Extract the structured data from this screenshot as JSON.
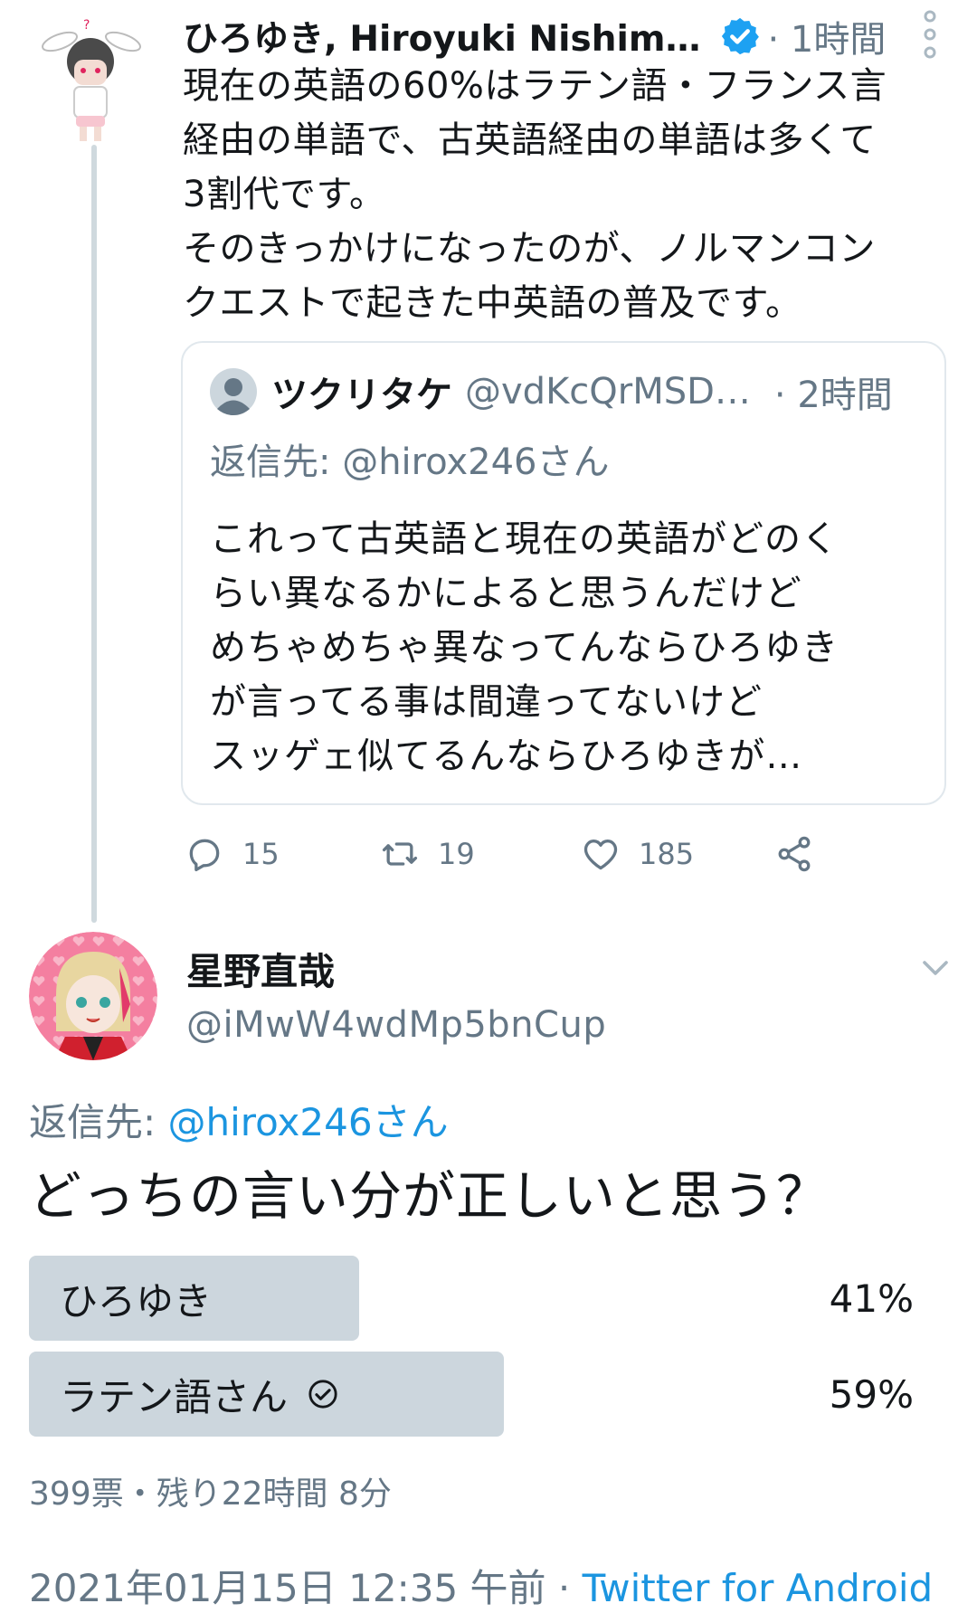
{
  "parent_tweet": {
    "author_name": "ひろゆき, Hiroyuki Nishim…",
    "time": "· 1時間",
    "text": "現在の英語の60%はラテン語・フランス言\n経由の単語で、古英語経由の単語は多くて\n3割代です。\nそのきっかけになったのが、ノルマンコン\nクエストで起きた中英語の普及です。",
    "quote": {
      "author_name": "ツクリタケ",
      "handle": "@vdKcQrMSD…",
      "time": "· 2時間",
      "reply_to": "返信先: @hirox246さん",
      "text": "これって古英語と現在の英語がどのく\nらい異なるかによると思うんだけど\nめちゃめちゃ異なってんならひろゆき\nが言ってる事は間違ってないけど\nスッゲェ似てるんならひろゆきが…"
    },
    "actions": {
      "replies": "15",
      "retweets": "19",
      "likes": "185"
    },
    "icons": [
      "verified-badge-icon",
      "more-icon",
      "reply-icon",
      "retweet-icon",
      "like-icon",
      "share-icon"
    ]
  },
  "main_tweet": {
    "author_name": "星野直哉",
    "handle": "@iMwW4wdMp5bnCup",
    "reply_to_label": "返信先: ",
    "reply_to_mention": "@hirox246さん",
    "text": "どっちの言い分が正しいと思う？",
    "poll": {
      "options": [
        {
          "label": "ひろゆき",
          "percent": "41%",
          "fraction": 0.41,
          "selected": false
        },
        {
          "label": "ラテン語さん",
          "percent": "59%",
          "fraction": 0.59,
          "selected": true
        }
      ],
      "meta": "399票・残り22時間 8分"
    },
    "timestamp": "2021年01月15日 12:35 午前 · ",
    "client": "Twitter for Android"
  },
  "colors": {
    "link": "#1b95e0",
    "secondary_text": "#657786",
    "poll_bar": "#ccd6dd",
    "verified": "#1da1f2"
  }
}
